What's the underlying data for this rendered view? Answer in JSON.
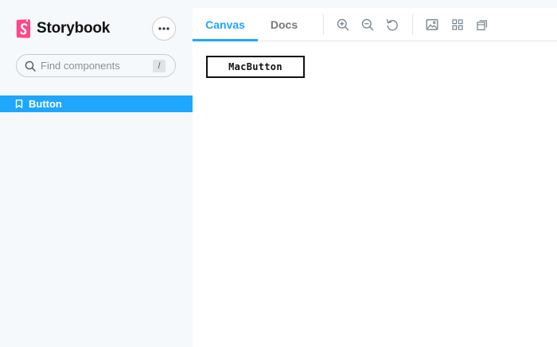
{
  "sidebar": {
    "brand": {
      "name": "Storybook",
      "logo_color": "#ff4785"
    },
    "search": {
      "placeholder": "Find components",
      "shortcut": "/"
    },
    "items": [
      {
        "label": "Button",
        "selected": true
      }
    ]
  },
  "toolbar": {
    "tabs": [
      {
        "label": "Canvas",
        "active": true
      },
      {
        "label": "Docs",
        "active": false
      }
    ],
    "tools": [
      "zoom-in-icon",
      "zoom-out-icon",
      "reset-zoom-icon",
      "background-icon",
      "grid-icon",
      "viewport-icon"
    ]
  },
  "canvas": {
    "button_label": "MacButton"
  },
  "colors": {
    "accent": "#1ea7fd",
    "sidebar_bg": "#f6f9fc",
    "icon": "#73828c"
  }
}
